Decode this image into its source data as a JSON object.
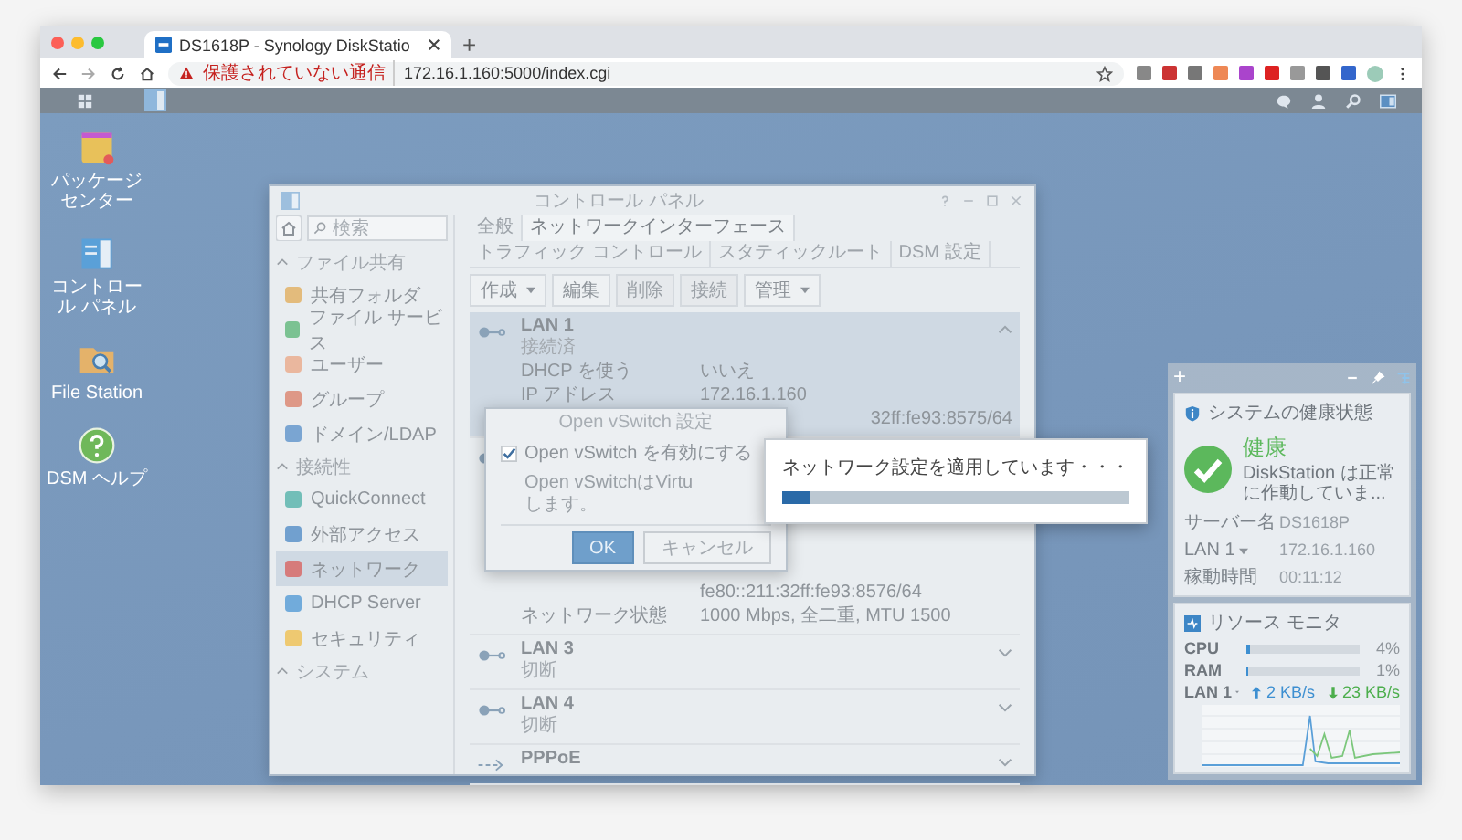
{
  "browser": {
    "tab_title": "DS1618P - Synology DiskStatio",
    "new_tab": "+",
    "security_warning": "保護されていない通信",
    "url": "172.16.1.160:5000/index.cgi"
  },
  "desktop_icons": [
    {
      "label": "パッケージセンター",
      "kind": "package"
    },
    {
      "label": "コントロール パネル",
      "kind": "control"
    },
    {
      "label": "File Station",
      "kind": "folder"
    },
    {
      "label": "DSM ヘルプ",
      "kind": "help"
    }
  ],
  "control_panel": {
    "title": "コントロール パネル",
    "search_placeholder": "検索",
    "sidebar": [
      {
        "kind": "heading",
        "label": "ファイル共有",
        "expanded": true
      },
      {
        "kind": "item",
        "label": "共有フォルダ",
        "selected": false
      },
      {
        "kind": "item",
        "label": "ファイル サービス",
        "selected": false
      },
      {
        "kind": "item",
        "label": "ユーザー",
        "selected": false
      },
      {
        "kind": "item",
        "label": "グループ",
        "selected": false
      },
      {
        "kind": "item",
        "label": "ドメイン/LDAP",
        "selected": false
      },
      {
        "kind": "heading",
        "label": "接続性",
        "expanded": true
      },
      {
        "kind": "item",
        "label": "QuickConnect",
        "selected": false
      },
      {
        "kind": "item",
        "label": "外部アクセス",
        "selected": false
      },
      {
        "kind": "item",
        "label": "ネットワーク",
        "selected": true
      },
      {
        "kind": "item",
        "label": "DHCP Server",
        "selected": false
      },
      {
        "kind": "item",
        "label": "セキュリティ",
        "selected": false
      },
      {
        "kind": "heading",
        "label": "システム",
        "expanded": true
      }
    ],
    "tabs": [
      {
        "label": "全般",
        "selected": false
      },
      {
        "label": "ネットワークインターフェース",
        "selected": true
      },
      {
        "label": "トラフィック コントロール",
        "selected": false
      },
      {
        "label": "スタティックルート",
        "selected": false
      },
      {
        "label": "DSM 設定",
        "selected": false
      }
    ],
    "toolbar": [
      {
        "label": "作成",
        "disabled": false,
        "dropdown": true
      },
      {
        "label": "編集",
        "disabled": false,
        "dropdown": false
      },
      {
        "label": "削除",
        "disabled": true,
        "dropdown": false
      },
      {
        "label": "接続",
        "disabled": true,
        "dropdown": false
      },
      {
        "label": "管理",
        "disabled": false,
        "dropdown": true
      }
    ],
    "interfaces": [
      {
        "kind": "lan",
        "name": "LAN 1",
        "status": "接続済",
        "selected": true,
        "expanded": true,
        "rows": [
          {
            "kind": "field",
            "label": "DHCP を使う",
            "value": "いいえ"
          },
          {
            "kind": "field",
            "label": "IP アドレス",
            "value": "172.16.1.160"
          },
          {
            "kind": "fragment",
            "value": "32ff:fe93:8575/64"
          }
        ]
      },
      {
        "kind": "lan",
        "selected": false,
        "expanded": true,
        "rows": [
          {
            "kind": "field",
            "value": "fe80::211:32ff:fe93:8576/64"
          },
          {
            "kind": "field",
            "label": "ネットワーク状態",
            "value": "1000 Mbps, 全二重, MTU 1500"
          }
        ]
      },
      {
        "kind": "lan",
        "name": "LAN 3",
        "status": "切断",
        "selected": false,
        "expanded": false
      },
      {
        "kind": "lan",
        "name": "LAN 4",
        "status": "切断",
        "selected": false,
        "expanded": false
      },
      {
        "kind": "pppoe",
        "name": "PPPoE",
        "selected": false,
        "expanded": false
      }
    ]
  },
  "vswitch_dialog": {
    "title": "Open vSwitch 設定",
    "checkbox": {
      "label": "Open vSwitch を有効にする",
      "checked": true
    },
    "description": [
      "Open vSwitchはVirtu",
      "します。"
    ],
    "buttons": [
      {
        "label": "OK",
        "kind": "primary"
      },
      {
        "label": "キャンセル",
        "kind": "secondary"
      }
    ]
  },
  "progress_dialog": {
    "message": "ネットワーク設定を適用しています・・・",
    "level": 0.08
  },
  "widgets": {
    "add": "+",
    "health": {
      "title": "システムの健康状態",
      "status": "健康",
      "message": "DiskStation は正常に作動していま...",
      "rows": [
        {
          "label": "サーバー名",
          "value": "DS1618P",
          "dropdown": false
        },
        {
          "label": "LAN 1",
          "value": "172.16.1.160",
          "dropdown": true
        },
        {
          "label": "稼動時間",
          "value": "00:11:12",
          "dropdown": false
        }
      ]
    },
    "resource": {
      "title": "リソース モニタ",
      "meters": [
        {
          "label": "CPU",
          "level": 0.04,
          "reading": "4%"
        },
        {
          "label": "RAM",
          "level": 0.01,
          "reading": "1%"
        }
      ],
      "network": {
        "label": "LAN 1",
        "upload": "2 KB/s",
        "download": "23 KB/s"
      }
    }
  }
}
